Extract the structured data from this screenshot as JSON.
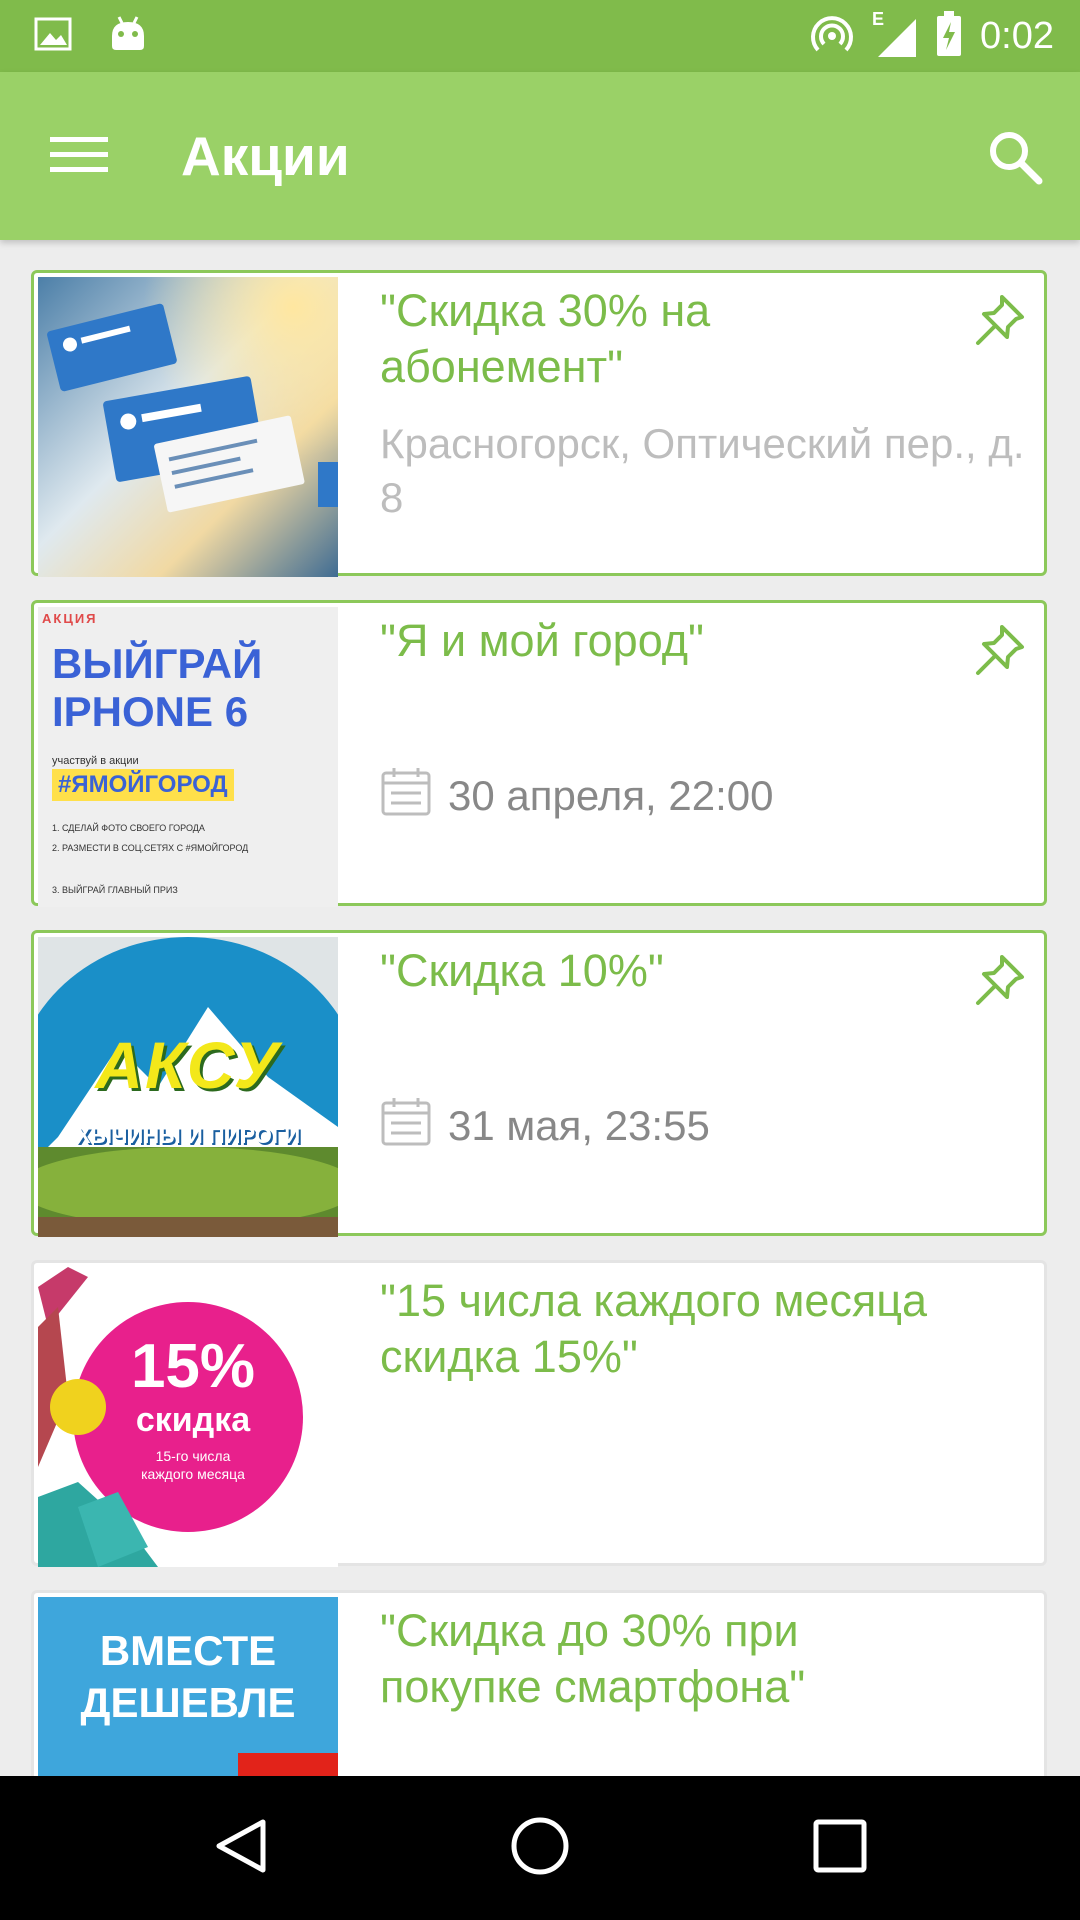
{
  "status_bar": {
    "time": "0:02",
    "network_type": "E",
    "icons": [
      "image-icon",
      "android-icon",
      "hotspot-icon",
      "signal-icon",
      "battery-charging-icon"
    ]
  },
  "app_bar": {
    "title": "Акции",
    "menu_icon": "menu-icon",
    "search_icon": "search-icon",
    "color": "#9ad167"
  },
  "promotions": [
    {
      "title": "\"Скидка 30% на абонемент\"",
      "address": "Красногорск, Оптический пер., д. 8",
      "pinned": true
    },
    {
      "title": "\"Я и мой город\"",
      "date": "30 апреля, 22:00",
      "pinned": true,
      "image": {
        "tag": "АКЦИЯ",
        "headline_1": "ВЫЙГРАЙ",
        "headline_2": "IPHONE 6",
        "small": "участвуй в акции",
        "hashtag": "#ЯМОЙГОРОД",
        "steps": [
          "1. СДЕЛАЙ ФОТО СВОЕГО ГОРОДА",
          "2. РАЗМЕСТИ В СОЦ.СЕТЯХ С #ЯМОЙГОРОД",
          "3. ВЫЙГРАЙ ГЛАВНЫЙ ПРИЗ"
        ]
      }
    },
    {
      "title": "\"Скидка 10%\"",
      "date": "31 мая, 23:55",
      "pinned": true,
      "image": {
        "logo": "АКСУ",
        "subtitle": "ХЫЧИНЫ И ПИРОГИ"
      }
    },
    {
      "title": "\"15 числа каждого месяца скидка 15%\"",
      "pinned": false,
      "image": {
        "percent": "15%",
        "word": "скидка",
        "note": "15-го числа каждого месяца"
      }
    },
    {
      "title": "\"Скидка до 30% при покупке смартфона\"",
      "pinned": false,
      "image": {
        "line_1": "ВМЕСТЕ",
        "line_2": "ДЕШЕВЛЕ"
      }
    }
  ],
  "nav_bar": {
    "back": "back-icon",
    "home": "home-icon",
    "recents": "recents-icon"
  }
}
